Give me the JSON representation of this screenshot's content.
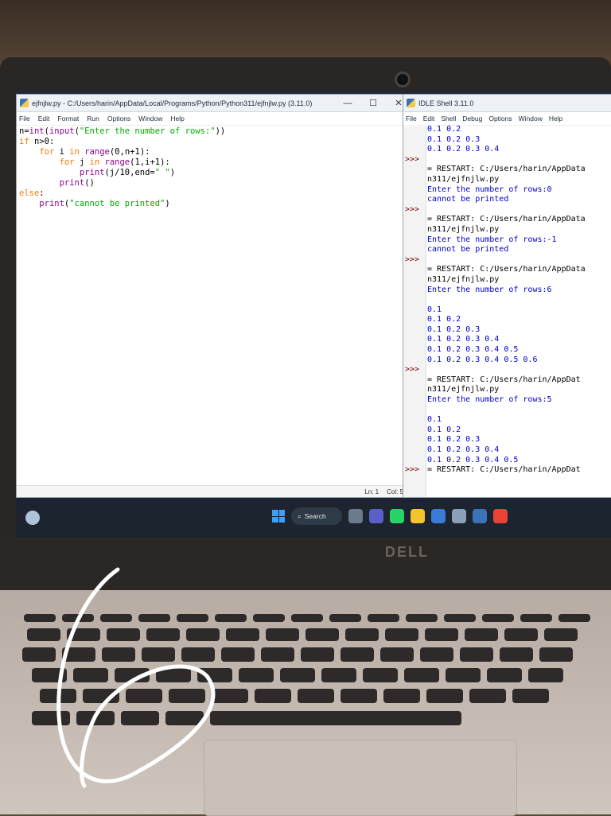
{
  "editor": {
    "title": "ejfnjlw.py - C:/Users/harin/AppData/Local/Programs/Python/Python311/ejfnjlw.py (3.11.0)",
    "menu": [
      "File",
      "Edit",
      "Format",
      "Run",
      "Options",
      "Window",
      "Help"
    ],
    "code_lines": [
      "n=int(input(\"Enter the number of rows:\"))",
      "if n>0:",
      "    for i in range(0,n+1):",
      "        for j in range(1,i+1):",
      "            print(j/10,end=\" \")",
      "        print()",
      "else:",
      "    print(\"cannot be printed\")"
    ],
    "status_ln": "Ln: 1",
    "status_col": "Col: 5",
    "win_controls": [
      "—",
      "☐",
      "✕"
    ]
  },
  "shell": {
    "title": "IDLE Shell 3.11.0",
    "menu": [
      "File",
      "Edit",
      "Shell",
      "Debug",
      "Options",
      "Window",
      "Help"
    ],
    "lines": [
      {
        "prompt": "",
        "text": "0.1 0.2",
        "kind": "stdout"
      },
      {
        "prompt": "",
        "text": "0.1 0.2 0.3",
        "kind": "stdout"
      },
      {
        "prompt": "",
        "text": "0.1 0.2 0.3 0.4",
        "kind": "stdout"
      },
      {
        "prompt": ">>>",
        "text": "",
        "kind": "restart"
      },
      {
        "prompt": "",
        "text": "= RESTART: C:/Users/harin/AppData",
        "kind": "restart"
      },
      {
        "prompt": "",
        "text": "n311/ejfnjlw.py",
        "kind": "restart"
      },
      {
        "prompt": "",
        "text": "Enter the number of rows:0",
        "kind": "stdout"
      },
      {
        "prompt": "",
        "text": "cannot be printed",
        "kind": "stdout"
      },
      {
        "prompt": ">>>",
        "text": "",
        "kind": "restart"
      },
      {
        "prompt": "",
        "text": "= RESTART: C:/Users/harin/AppData",
        "kind": "restart"
      },
      {
        "prompt": "",
        "text": "n311/ejfnjlw.py",
        "kind": "restart"
      },
      {
        "prompt": "",
        "text": "Enter the number of rows:-1",
        "kind": "stdout"
      },
      {
        "prompt": "",
        "text": "cannot be printed",
        "kind": "stdout"
      },
      {
        "prompt": ">>>",
        "text": "",
        "kind": "restart"
      },
      {
        "prompt": "",
        "text": "= RESTART: C:/Users/harin/AppData",
        "kind": "restart"
      },
      {
        "prompt": "",
        "text": "n311/ejfnjlw.py",
        "kind": "restart"
      },
      {
        "prompt": "",
        "text": "Enter the number of rows:6",
        "kind": "stdout"
      },
      {
        "prompt": "",
        "text": "",
        "kind": "stdout"
      },
      {
        "prompt": "",
        "text": "0.1",
        "kind": "stdout"
      },
      {
        "prompt": "",
        "text": "0.1 0.2",
        "kind": "stdout"
      },
      {
        "prompt": "",
        "text": "0.1 0.2 0.3",
        "kind": "stdout"
      },
      {
        "prompt": "",
        "text": "0.1 0.2 0.3 0.4",
        "kind": "stdout"
      },
      {
        "prompt": "",
        "text": "0.1 0.2 0.3 0.4 0.5",
        "kind": "stdout"
      },
      {
        "prompt": "",
        "text": "0.1 0.2 0.3 0.4 0.5 0.6",
        "kind": "stdout"
      },
      {
        "prompt": ">>>",
        "text": "",
        "kind": "restart"
      },
      {
        "prompt": "",
        "text": "= RESTART: C:/Users/harin/AppDat",
        "kind": "restart"
      },
      {
        "prompt": "",
        "text": "n311/ejfnjlw.py",
        "kind": "restart"
      },
      {
        "prompt": "",
        "text": "Enter the number of rows:5",
        "kind": "stdout"
      },
      {
        "prompt": "",
        "text": "",
        "kind": "stdout"
      },
      {
        "prompt": "",
        "text": "0.1",
        "kind": "stdout"
      },
      {
        "prompt": "",
        "text": "0.1 0.2",
        "kind": "stdout"
      },
      {
        "prompt": "",
        "text": "0.1 0.2 0.3",
        "kind": "stdout"
      },
      {
        "prompt": "",
        "text": "0.1 0.2 0.3 0.4",
        "kind": "stdout"
      },
      {
        "prompt": "",
        "text": "0.1 0.2 0.3 0.4 0.5",
        "kind": "stdout"
      },
      {
        "prompt": ">>>",
        "text": "= RESTART: C:/Users/harin/AppDat",
        "kind": "restart"
      }
    ]
  },
  "taskbar": {
    "search_label": "Search",
    "icons": [
      "file-explorer-icon",
      "teams-icon",
      "whatsapp-icon",
      "folder-icon",
      "store-icon",
      "settings-icon",
      "python-idle-icon",
      "chrome-icon"
    ],
    "icon_colors": [
      "#6b7a8c",
      "#5b5fc7",
      "#25d366",
      "#f4c430",
      "#3a7bd5",
      "#8aa0b8",
      "#3b73b9",
      "#ea4335"
    ]
  },
  "brand": "DELL"
}
